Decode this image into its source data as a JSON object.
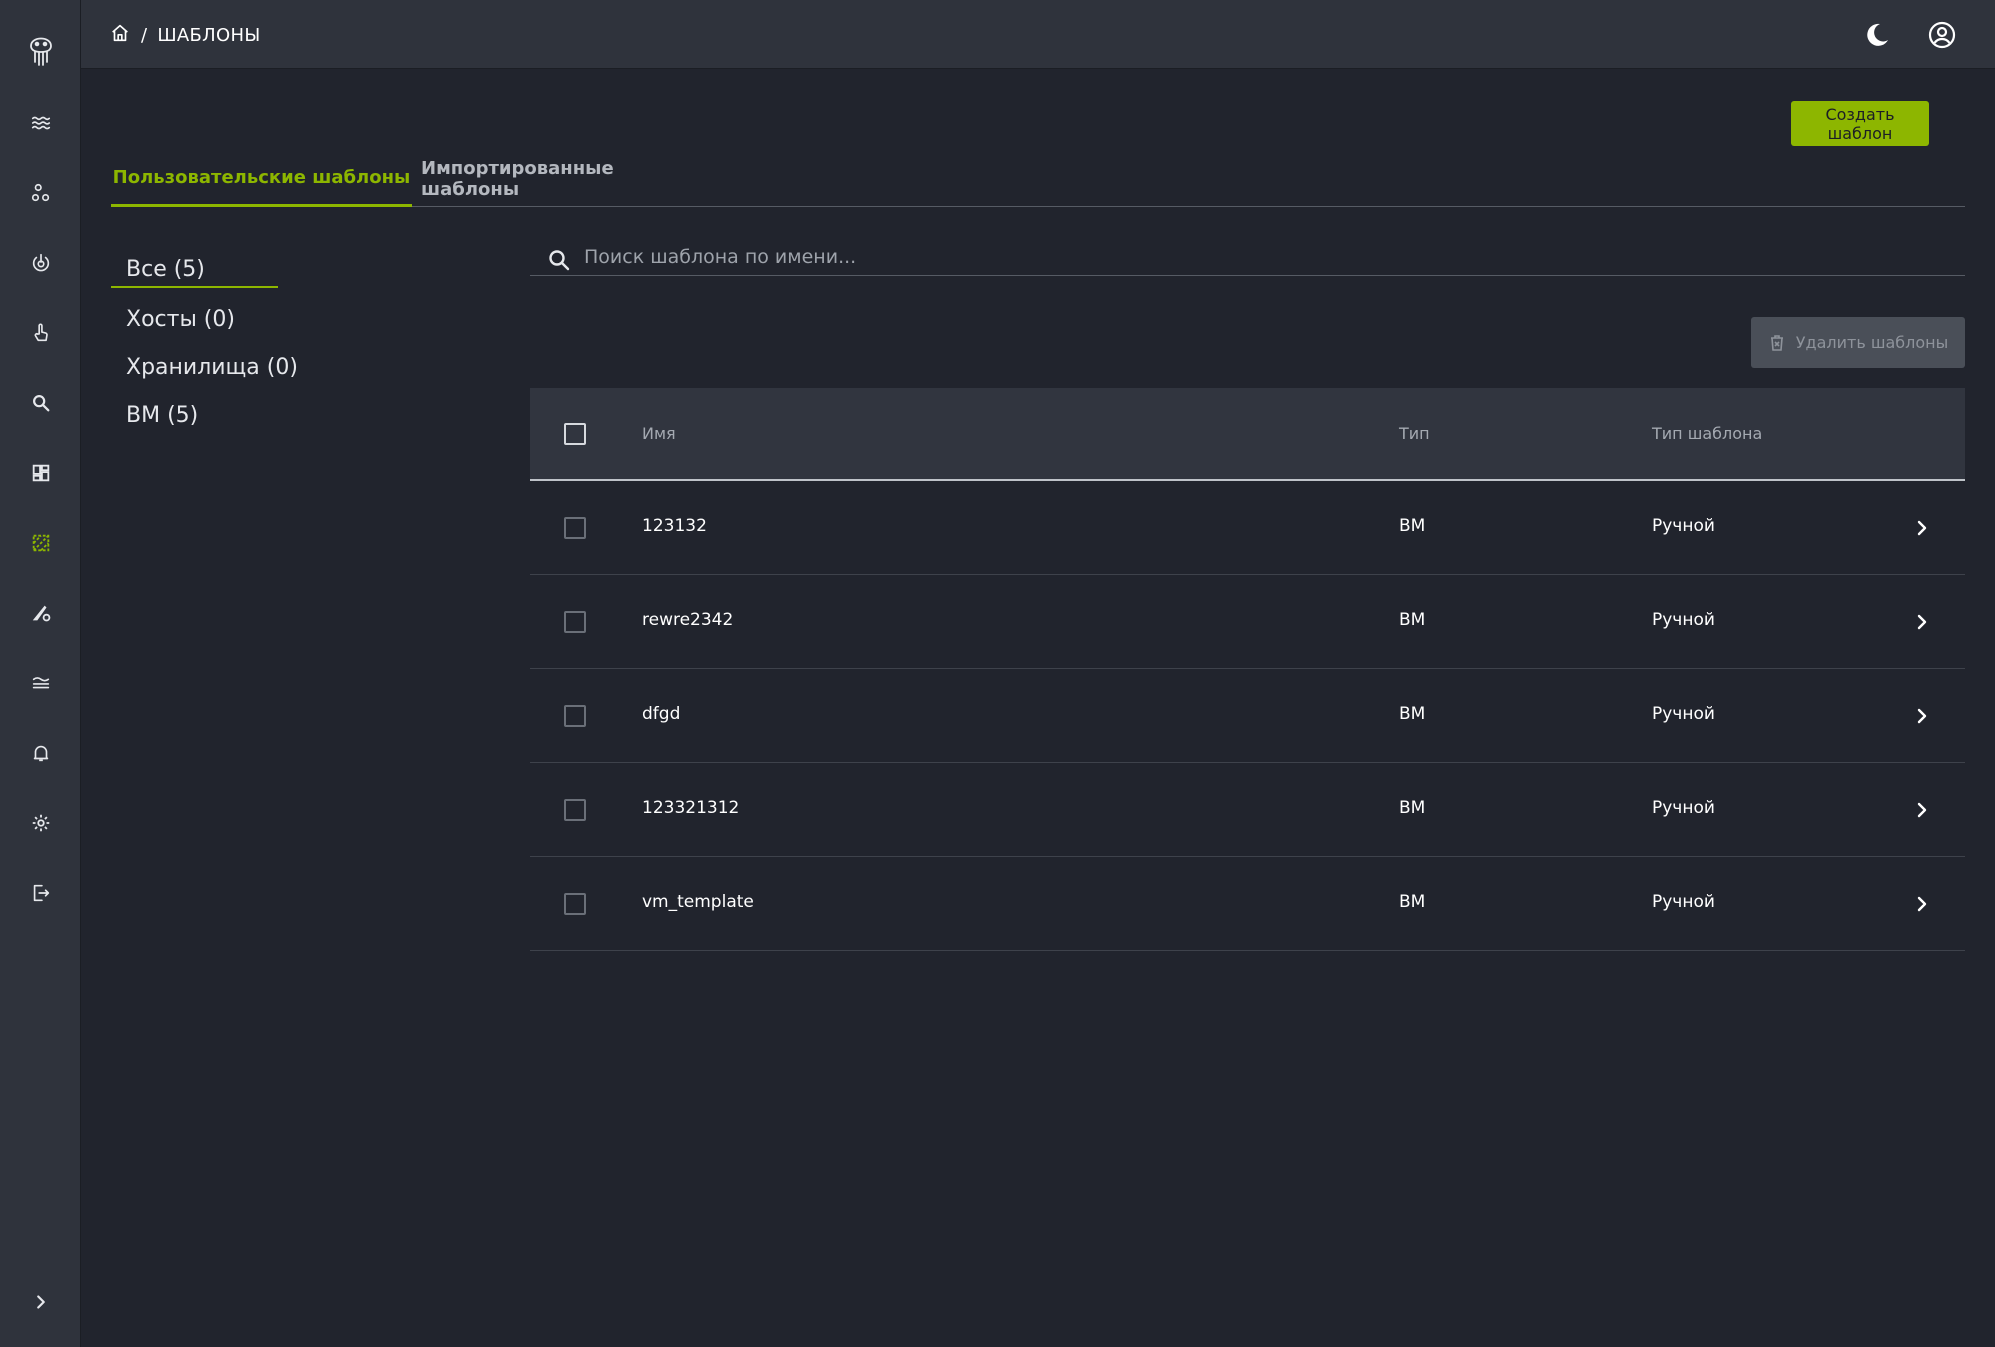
{
  "sidebar": {
    "icons": [
      "logo-icon",
      "waves-icon",
      "nodes-icon",
      "power-icon",
      "hand-pointer-icon",
      "search-icon",
      "dashboard-icon",
      "templates-icon",
      "tools-settings-icon",
      "layers-icon",
      "bell-icon",
      "gear-icon",
      "logout-icon",
      "expand-chevron-icon"
    ],
    "active_icon": "templates-icon",
    "accent_color": "#8db600"
  },
  "topbar": {
    "breadcrumb_separator": "/",
    "breadcrumb_current": "ШАБЛОНЫ"
  },
  "actions": {
    "create_label": "Создать шаблон",
    "delete_label": "Удалить шаблоны"
  },
  "tabs": [
    {
      "label": "Пользовательские шаблоны",
      "active": true
    },
    {
      "label": "Импортированные шаблоны",
      "active": false
    }
  ],
  "filters": [
    {
      "label": "Все (5)",
      "active": true
    },
    {
      "label": "Хосты (0)",
      "active": false
    },
    {
      "label": "Хранилища (0)",
      "active": false
    },
    {
      "label": "ВМ (5)",
      "active": false
    }
  ],
  "search": {
    "placeholder": "Поиск шаблона по имени..."
  },
  "table": {
    "columns": [
      "Имя",
      "Тип",
      "Тип шаблона"
    ],
    "rows": [
      {
        "name": "123132",
        "type": "ВМ",
        "template_type": "Ручной"
      },
      {
        "name": "rewre2342",
        "type": "ВМ",
        "template_type": "Ручной"
      },
      {
        "name": "dfgd",
        "type": "ВМ",
        "template_type": "Ручной"
      },
      {
        "name": "123321312",
        "type": "ВМ",
        "template_type": "Ручной"
      },
      {
        "name": "vm_template",
        "type": "ВМ",
        "template_type": "Ручной"
      }
    ]
  }
}
